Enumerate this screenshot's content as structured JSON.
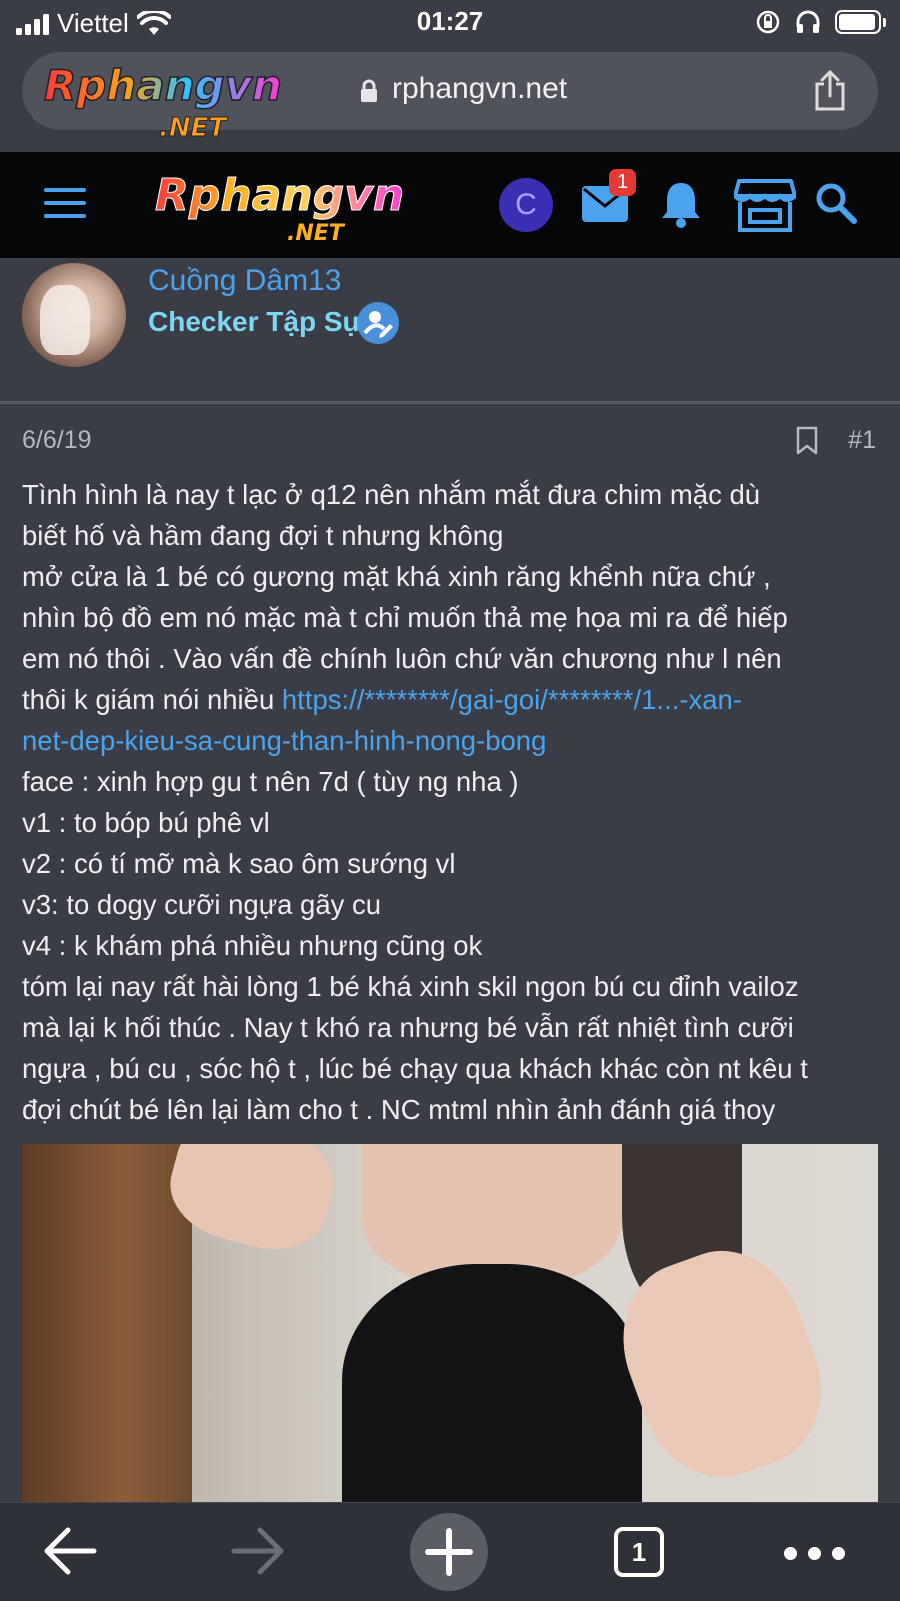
{
  "status_bar": {
    "carrier": "Viettel",
    "time": "01:27",
    "battery_level": 0.9
  },
  "browser": {
    "url": "rphangvn.net",
    "site_logo_text": "Rphangvn",
    "site_logo_suffix": ".NET"
  },
  "site_header": {
    "logo_text": "Rphangvn",
    "logo_suffix": ".NET",
    "account_initial": "C",
    "inbox_badge": "1",
    "accent_color": "#4aa3ec"
  },
  "post": {
    "author": "Cuồng Dâm13",
    "author_title": "Checker Tập Sự",
    "date": "6/6/19",
    "number": "#1",
    "lines": [
      "Tình hình là nay t lạc ở q12 nên nhắm mắt đưa chim mặc dù",
      "biết hố và hầm đang đợi t nhưng không",
      "mở cửa là 1 bé có gương mặt khá xinh răng khểnh nữa chứ ,",
      "nhìn bộ đồ em nó mặc mà t chỉ muốn thả mẹ họa mi ra để hiếp",
      "em nó thôi . Vào vấn đề chính luôn chứ văn chương như l nên"
    ],
    "line_before_link": "thôi k giám nói nhiều ",
    "link_part1": "https://********/gai-goi/********/1...-xan-",
    "link_part2": "net-dep-kieu-sa-cung-than-hinh-nong-bong",
    "lines_after": [
      "face : xinh hợp gu t nên 7d ( tùy ng nha )",
      "v1 : to bóp bú phê vl",
      "v2 : có tí mỡ mà k sao ôm sướng vl",
      "v3: to dogy cưỡi ngựa gãy cu",
      "v4 : k khám phá nhiều nhưng cũng ok",
      "tóm lại nay rất hài lòng 1 bé khá xinh skil ngon bú cu đỉnh vailoz",
      "mà lại k hối thúc . Nay t khó ra nhưng bé vẫn rất nhiệt tình cưỡi",
      "ngựa , bú cu , sóc hộ t , lúc bé chạy qua khách khác còn nt kêu t",
      "đợi chút bé lên lại làm cho t . NC mtml nhìn ảnh đánh giá thoy"
    ]
  },
  "toolbar": {
    "tab_count": "1"
  }
}
